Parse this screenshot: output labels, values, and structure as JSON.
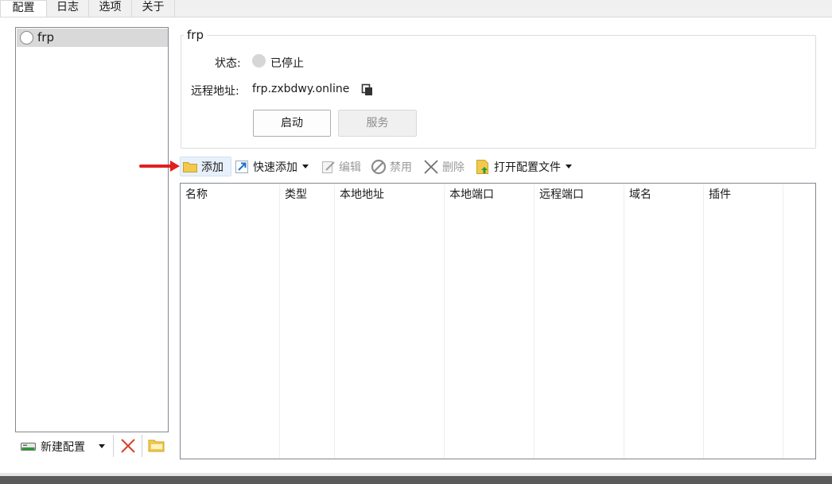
{
  "tabs": [
    {
      "label": "配置",
      "active": true
    },
    {
      "label": "日志",
      "active": false
    },
    {
      "label": "选项",
      "active": false
    },
    {
      "label": "关于",
      "active": false
    }
  ],
  "sidebar": {
    "profiles": [
      {
        "name": "frp",
        "selected": true
      }
    ],
    "toolbar": {
      "new_config_label": "新建配置"
    }
  },
  "detail": {
    "group_title": "frp",
    "status_label": "状态:",
    "status_value": "已停止",
    "remote_label": "远程地址:",
    "remote_value": "frp.zxbdwy.online",
    "start_button": "启动",
    "service_button": "服务"
  },
  "toolbar": {
    "add": "添加",
    "quick_add": "快速添加",
    "edit": "编辑",
    "disable": "禁用",
    "delete": "删除",
    "open_config": "打开配置文件"
  },
  "table": {
    "columns": [
      "名称",
      "类型",
      "本地地址",
      "本地端口",
      "远程端口",
      "域名",
      "插件"
    ],
    "rows": []
  },
  "colors": {
    "annotation_arrow": "#e02020",
    "selected_bg": "#d9d9d9",
    "delete_red": "#d9402b"
  }
}
